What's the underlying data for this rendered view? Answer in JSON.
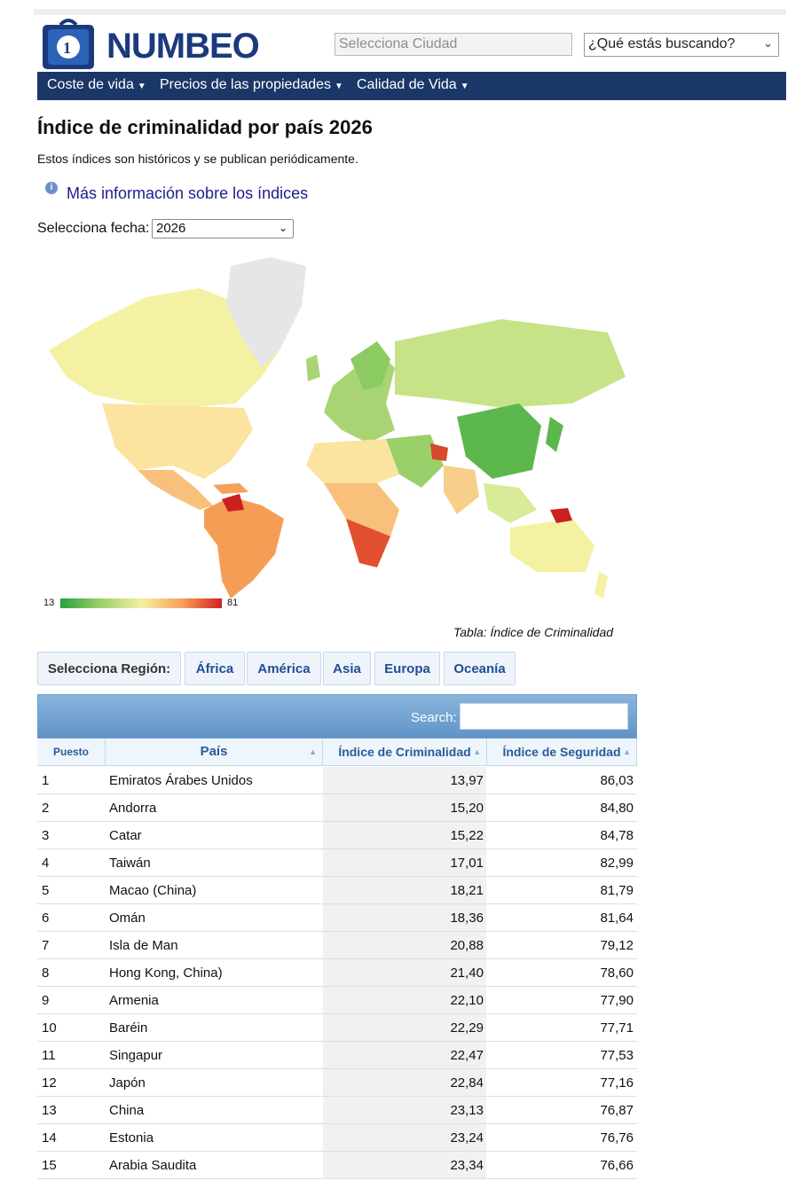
{
  "brand": {
    "name": "NUMBEO",
    "navy": "#1b3768",
    "logo_color": "#1b3a7e"
  },
  "search_city": {
    "placeholder": "Selecciona Ciudad"
  },
  "what_select": {
    "value": "¿Qué estás buscando?"
  },
  "nav": {
    "items": [
      {
        "label": "Coste de vida"
      },
      {
        "label": "Precios de las propiedades"
      },
      {
        "label": "Calidad de Vida"
      }
    ]
  },
  "page": {
    "title": "Índice de criminalidad por país 2026",
    "subtitle": "Estos índices son históricos y se publican periódicamente.",
    "info_link": "Más información sobre los índices",
    "date_label": "Selecciona fecha:",
    "date_value": "2026"
  },
  "map": {
    "legend_min": "13",
    "legend_max": "81",
    "color_low": "#29a03c",
    "color_high": "#d42020",
    "caption": "Tabla: Índice de Criminalidad"
  },
  "regions": {
    "label": "Selecciona Región:",
    "tabs": [
      "África",
      "América",
      "Asia",
      "Europa",
      "Oceanía"
    ]
  },
  "table": {
    "search_label": "Search:",
    "columns": [
      "Puesto",
      "País",
      "Índice de Criminalidad",
      "Índice de Seguridad"
    ],
    "rows": [
      {
        "rank": "1",
        "country": "Emiratos Árabes Unidos",
        "crime": "13,97",
        "safety": "86,03"
      },
      {
        "rank": "2",
        "country": "Andorra",
        "crime": "15,20",
        "safety": "84,80"
      },
      {
        "rank": "3",
        "country": "Catar",
        "crime": "15,22",
        "safety": "84,78"
      },
      {
        "rank": "4",
        "country": "Taiwán",
        "crime": "17,01",
        "safety": "82,99"
      },
      {
        "rank": "5",
        "country": "Macao (China)",
        "crime": "18,21",
        "safety": "81,79"
      },
      {
        "rank": "6",
        "country": "Omán",
        "crime": "18,36",
        "safety": "81,64"
      },
      {
        "rank": "7",
        "country": "Isla de Man",
        "crime": "20,88",
        "safety": "79,12"
      },
      {
        "rank": "8",
        "country": "Hong Kong, China)",
        "crime": "21,40",
        "safety": "78,60"
      },
      {
        "rank": "9",
        "country": "Armenia",
        "crime": "22,10",
        "safety": "77,90"
      },
      {
        "rank": "10",
        "country": "Baréin",
        "crime": "22,29",
        "safety": "77,71"
      },
      {
        "rank": "11",
        "country": "Singapur",
        "crime": "22,47",
        "safety": "77,53"
      },
      {
        "rank": "12",
        "country": "Japón",
        "crime": "22,84",
        "safety": "77,16"
      },
      {
        "rank": "13",
        "country": "China",
        "crime": "23,13",
        "safety": "76,87"
      },
      {
        "rank": "14",
        "country": "Estonia",
        "crime": "23,24",
        "safety": "76,76"
      },
      {
        "rank": "15",
        "country": "Arabia Saudita",
        "crime": "23,34",
        "safety": "76,66"
      }
    ]
  }
}
